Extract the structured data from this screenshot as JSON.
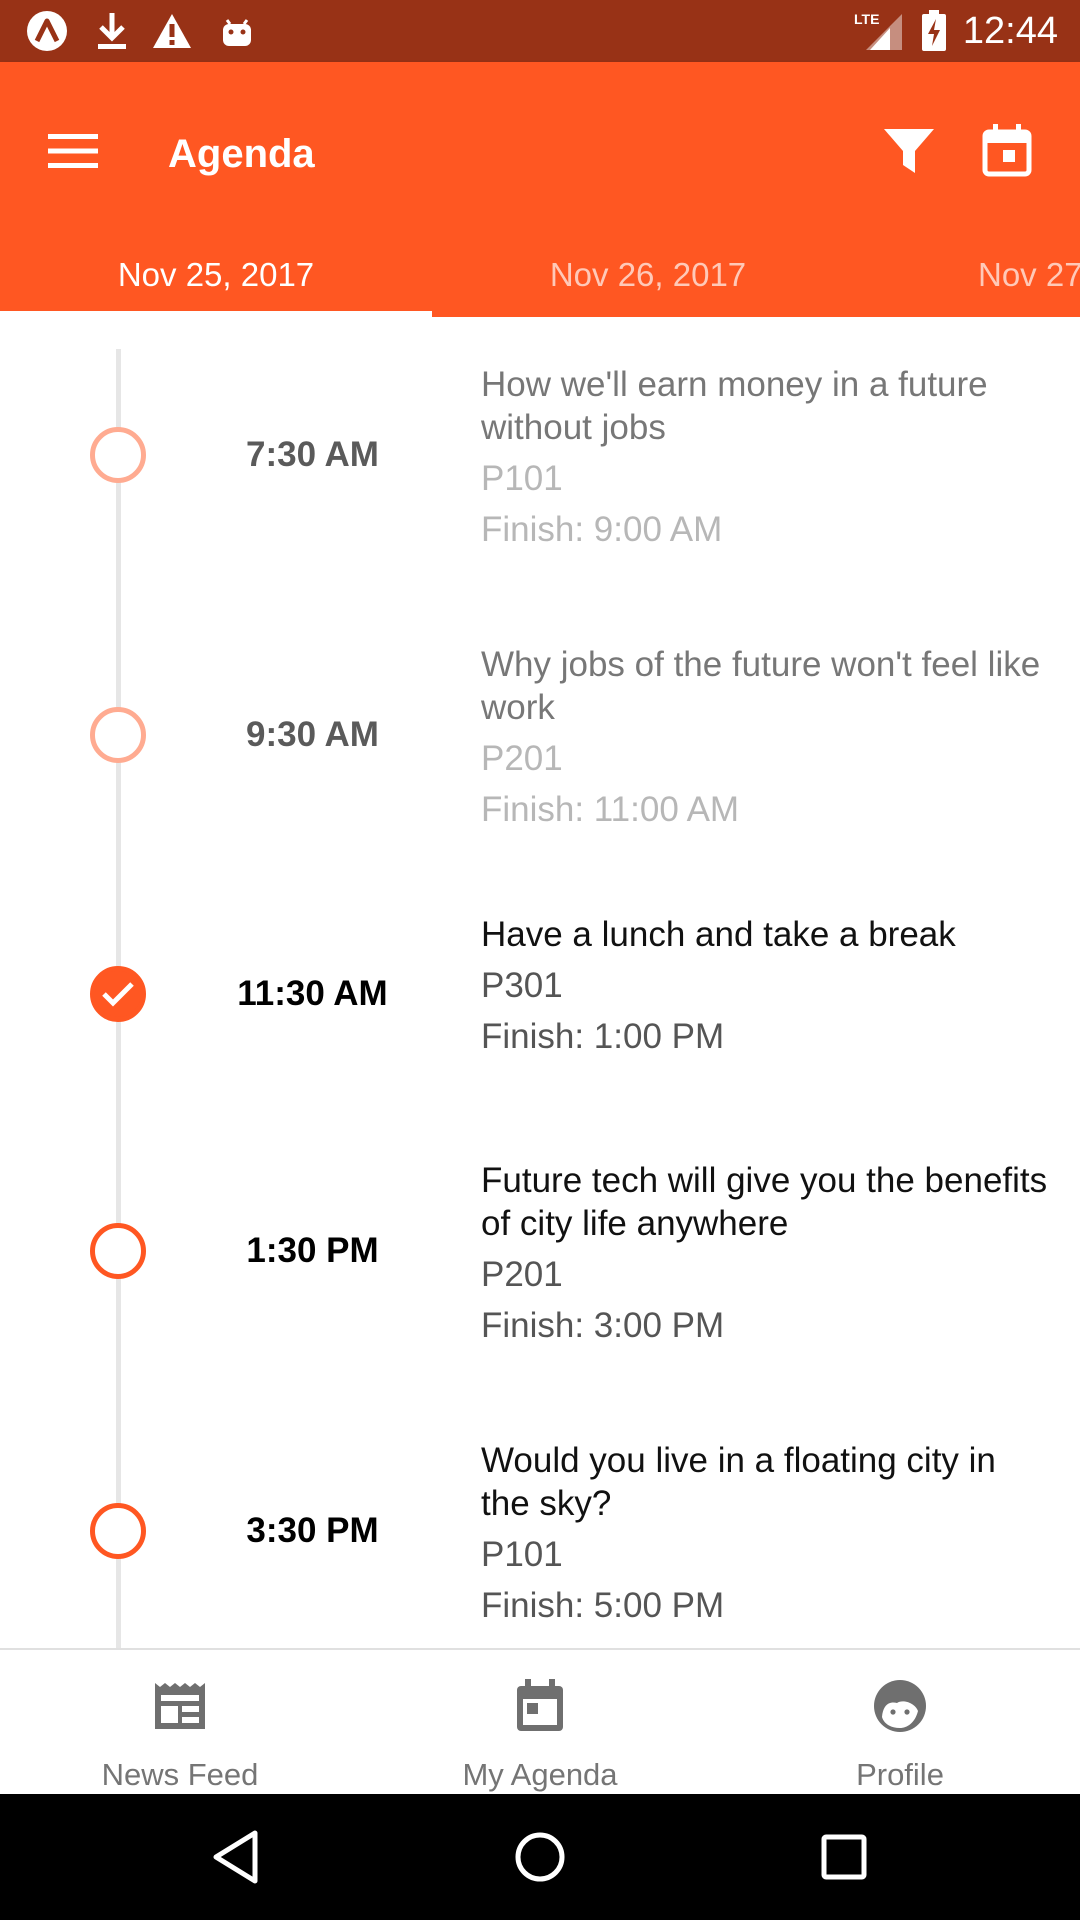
{
  "status_bar": {
    "time": "12:44",
    "network": "LTE",
    "icons": [
      "app-notification-icon",
      "download-icon",
      "warning-icon",
      "android-icon",
      "lte-signal-icon",
      "battery-charging-icon"
    ]
  },
  "app_bar": {
    "title": "Agenda",
    "menu_icon": "hamburger-menu-icon",
    "actions": [
      "filter-icon",
      "calendar-icon"
    ],
    "background_color": "#ff5722"
  },
  "tabs": [
    {
      "label": "Nov 25, 2017",
      "active": true
    },
    {
      "label": "Nov 26, 2017",
      "active": false
    },
    {
      "label": "Nov 27",
      "active": false
    }
  ],
  "agenda": [
    {
      "time": "7:30 AM",
      "title": "How we'll earn money in a future without jobs",
      "room": "P101",
      "finish": "Finish: 9:00 AM",
      "state": "past"
    },
    {
      "time": "9:30 AM",
      "title": "Why jobs of the future won't feel like work",
      "room": "P201",
      "finish": "Finish: 11:00 AM",
      "state": "past"
    },
    {
      "time": "11:30 AM",
      "title": "Have a lunch and take a break",
      "room": "P301",
      "finish": "Finish: 1:00 PM",
      "state": "checked"
    },
    {
      "time": "1:30 PM",
      "title": "Future tech will give you the benefits of city life anywhere",
      "room": "P201",
      "finish": "Finish: 3:00 PM",
      "state": "upcoming"
    },
    {
      "time": "3:30 PM",
      "title": "Would you live in a floating city in the sky?",
      "room": "P101",
      "finish": "Finish: 5:00 PM",
      "state": "upcoming"
    }
  ],
  "bottom_nav": [
    {
      "label": "News Feed",
      "icon": "news-feed-icon"
    },
    {
      "label": "My Agenda",
      "icon": "calendar-icon"
    },
    {
      "label": "Profile",
      "icon": "profile-icon"
    }
  ],
  "system_nav": [
    "back-icon",
    "home-icon",
    "recents-icon"
  ],
  "colors": {
    "accent": "#ff5722",
    "status_bar": "#983216",
    "past_dot": "#ffab91"
  }
}
